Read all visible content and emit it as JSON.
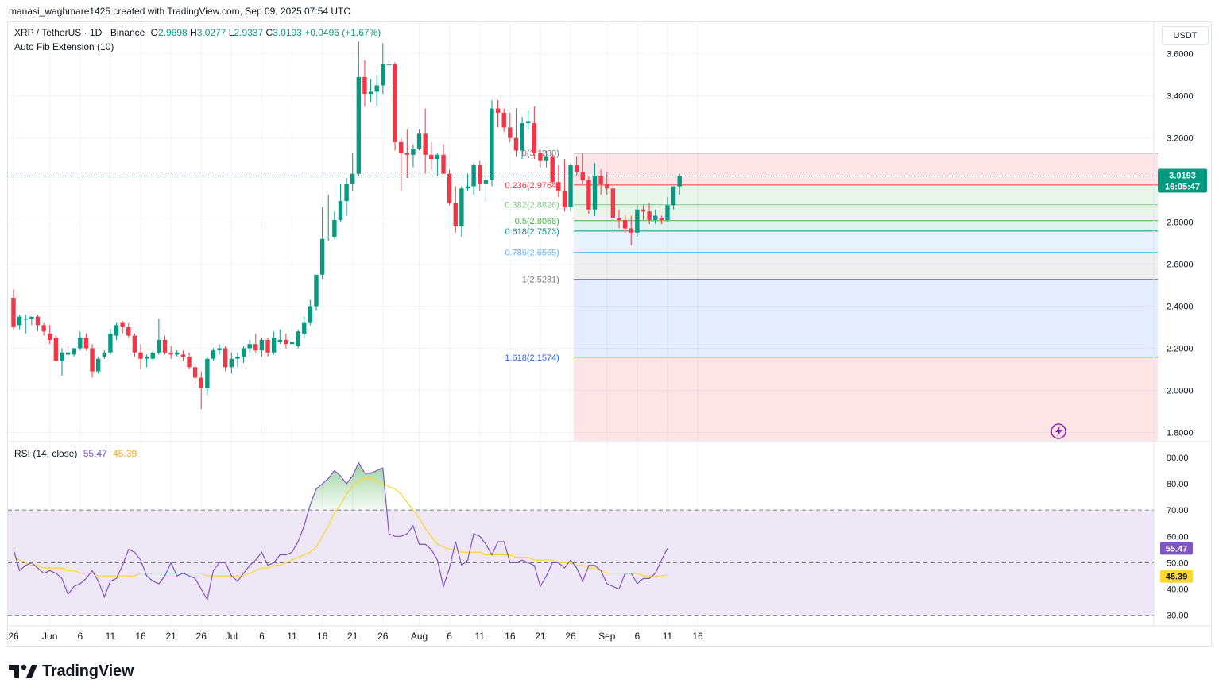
{
  "header": {
    "attribution": "manasi_waghmare1425 created with TradingView.com, Sep 09, 2025 07:54 UTC"
  },
  "legend": {
    "symbol": "XRP / TetherUS · 1D · Binance",
    "o_label": "O",
    "o_value": "2.9698",
    "h_label": "H",
    "h_value": "3.0277",
    "l_label": "L",
    "l_value": "2.9337",
    "c_label": "C",
    "c_value": "3.0193",
    "change": "+0.0496 (+1.67%)",
    "indicator": "Auto Fib Extension (10)"
  },
  "currency_button": "USDT",
  "rsi_legend": {
    "label": "RSI (14, close)",
    "rsi_value": "55.47",
    "ma_value": "45.39"
  },
  "price_badge": {
    "price": "3.0193",
    "countdown": "16:05:47"
  },
  "logo": {
    "text": "TradingView"
  },
  "colors": {
    "up": "#089981",
    "down": "#f23645",
    "rsi": "#7e57c2",
    "rsi_ma": "#fdd835",
    "rsi_band": "#ede7f6",
    "fib_line": "#787b86",
    "grid": "#f0f3fa"
  },
  "chart_data": [
    {
      "type": "candlestick",
      "title": "XRP / TetherUS · 1D · Binance",
      "ylim": [
        1.76,
        3.75
      ],
      "yticks": [
        1.8,
        2.0,
        2.2,
        2.4,
        2.6,
        2.8,
        3.0,
        3.2,
        3.4,
        3.6
      ],
      "ytick_labels": [
        "1.8000",
        "2.0000",
        "2.2000",
        "2.4000",
        "2.6000",
        "2.8000",
        "3.0000",
        "3.2000",
        "3.4000",
        "3.6000"
      ],
      "x_tick_labels": [
        {
          "day": 0,
          "label": "26"
        },
        {
          "day": 6,
          "label": "Jun"
        },
        {
          "day": 11,
          "label": "6"
        },
        {
          "day": 16,
          "label": "11"
        },
        {
          "day": 21,
          "label": "16"
        },
        {
          "day": 26,
          "label": "21"
        },
        {
          "day": 31,
          "label": "26"
        },
        {
          "day": 36,
          "label": "Jul"
        },
        {
          "day": 41,
          "label": "6"
        },
        {
          "day": 46,
          "label": "11"
        },
        {
          "day": 51,
          "label": "16"
        },
        {
          "day": 56,
          "label": "21"
        },
        {
          "day": 61,
          "label": "26"
        },
        {
          "day": 67,
          "label": "Aug"
        },
        {
          "day": 72,
          "label": "6"
        },
        {
          "day": 77,
          "label": "11"
        },
        {
          "day": 82,
          "label": "16"
        },
        {
          "day": 87,
          "label": "21"
        },
        {
          "day": 92,
          "label": "26"
        },
        {
          "day": 98,
          "label": "Sep"
        },
        {
          "day": 103,
          "label": "6"
        },
        {
          "day": 108,
          "label": "11"
        },
        {
          "day": 113,
          "label": "16"
        }
      ],
      "candles": [
        [
          2.44,
          2.48,
          2.29,
          2.3
        ],
        [
          2.31,
          2.36,
          2.29,
          2.35
        ],
        [
          2.34,
          2.36,
          2.27,
          2.34
        ],
        [
          2.34,
          2.35,
          2.31,
          2.35
        ],
        [
          2.35,
          2.36,
          2.28,
          2.31
        ],
        [
          2.31,
          2.32,
          2.26,
          2.28
        ],
        [
          2.27,
          2.31,
          2.22,
          2.24
        ],
        [
          2.25,
          2.26,
          2.14,
          2.14
        ],
        [
          2.14,
          2.2,
          2.07,
          2.18
        ],
        [
          2.17,
          2.21,
          2.15,
          2.18
        ],
        [
          2.17,
          2.2,
          2.16,
          2.2
        ],
        [
          2.2,
          2.28,
          2.19,
          2.25
        ],
        [
          2.25,
          2.27,
          2.19,
          2.2
        ],
        [
          2.2,
          2.22,
          2.06,
          2.09
        ],
        [
          2.09,
          2.16,
          2.08,
          2.15
        ],
        [
          2.16,
          2.19,
          2.15,
          2.18
        ],
        [
          2.18,
          2.29,
          2.17,
          2.27
        ],
        [
          2.26,
          2.32,
          2.24,
          2.31
        ],
        [
          2.32,
          2.33,
          2.27,
          2.3
        ],
        [
          2.3,
          2.32,
          2.25,
          2.26
        ],
        [
          2.26,
          2.27,
          2.16,
          2.18
        ],
        [
          2.18,
          2.22,
          2.1,
          2.15
        ],
        [
          2.15,
          2.17,
          2.11,
          2.16
        ],
        [
          2.15,
          2.19,
          2.14,
          2.18
        ],
        [
          2.18,
          2.34,
          2.17,
          2.24
        ],
        [
          2.24,
          2.26,
          2.17,
          2.18
        ],
        [
          2.18,
          2.21,
          2.15,
          2.17
        ],
        [
          2.17,
          2.19,
          2.16,
          2.18
        ],
        [
          2.17,
          2.19,
          2.14,
          2.16
        ],
        [
          2.16,
          2.18,
          2.1,
          2.11
        ],
        [
          2.11,
          2.13,
          2.03,
          2.06
        ],
        [
          2.06,
          2.09,
          1.91,
          2.01
        ],
        [
          2.01,
          2.16,
          1.98,
          2.15
        ],
        [
          2.15,
          2.2,
          2.14,
          2.19
        ],
        [
          2.19,
          2.22,
          2.17,
          2.2
        ],
        [
          2.2,
          2.21,
          2.09,
          2.11
        ],
        [
          2.11,
          2.18,
          2.08,
          2.15
        ],
        [
          2.15,
          2.18,
          2.11,
          2.16
        ],
        [
          2.16,
          2.21,
          2.13,
          2.2
        ],
        [
          2.2,
          2.24,
          2.18,
          2.22
        ],
        [
          2.22,
          2.27,
          2.18,
          2.19
        ],
        [
          2.19,
          2.25,
          2.16,
          2.24
        ],
        [
          2.24,
          2.25,
          2.16,
          2.18
        ],
        [
          2.18,
          2.28,
          2.17,
          2.25
        ],
        [
          2.23,
          2.29,
          2.22,
          2.24
        ],
        [
          2.24,
          2.27,
          2.2,
          2.22
        ],
        [
          2.22,
          2.27,
          2.21,
          2.23
        ],
        [
          2.21,
          2.29,
          2.2,
          2.28
        ],
        [
          2.27,
          2.35,
          2.25,
          2.32
        ],
        [
          2.32,
          2.43,
          2.31,
          2.4
        ],
        [
          2.4,
          2.54,
          2.38,
          2.55
        ],
        [
          2.55,
          2.87,
          2.53,
          2.72
        ],
        [
          2.73,
          2.93,
          2.71,
          2.73
        ],
        [
          2.73,
          2.85,
          2.72,
          2.81
        ],
        [
          2.81,
          2.98,
          2.8,
          2.9
        ],
        [
          2.9,
          3.01,
          2.83,
          2.98
        ],
        [
          2.98,
          3.13,
          2.95,
          3.03
        ],
        [
          3.03,
          3.66,
          3.02,
          3.49
        ],
        [
          3.49,
          3.57,
          3.35,
          3.41
        ],
        [
          3.41,
          3.48,
          3.37,
          3.42
        ],
        [
          3.42,
          3.5,
          3.35,
          3.45
        ],
        [
          3.45,
          3.65,
          3.41,
          3.55
        ],
        [
          3.55,
          3.57,
          3.44,
          3.55
        ],
        [
          3.55,
          3.56,
          3.14,
          3.18
        ],
        [
          3.18,
          3.2,
          2.95,
          3.13
        ],
        [
          3.13,
          3.24,
          3.01,
          3.12
        ],
        [
          3.12,
          3.17,
          3.06,
          3.15
        ],
        [
          3.15,
          3.24,
          3.14,
          3.22
        ],
        [
          3.22,
          3.34,
          3.03,
          3.12
        ],
        [
          3.12,
          3.18,
          3.05,
          3.1
        ],
        [
          3.1,
          3.13,
          3.02,
          3.12
        ],
        [
          3.12,
          3.17,
          3.04,
          3.03
        ],
        [
          3.03,
          3.05,
          2.88,
          2.89
        ],
        [
          2.89,
          2.97,
          2.75,
          2.78
        ],
        [
          2.78,
          2.97,
          2.73,
          2.96
        ],
        [
          2.96,
          3.03,
          2.95,
          2.97
        ],
        [
          2.97,
          3.08,
          2.93,
          3.07
        ],
        [
          3.07,
          3.09,
          2.95,
          2.98
        ],
        [
          2.98,
          3.08,
          2.9,
          3.0
        ],
        [
          3.0,
          3.38,
          2.97,
          3.34
        ],
        [
          3.34,
          3.38,
          3.25,
          3.32
        ],
        [
          3.32,
          3.34,
          3.23,
          3.25
        ],
        [
          3.25,
          3.32,
          3.18,
          3.2
        ],
        [
          3.2,
          3.34,
          3.11,
          3.14
        ],
        [
          3.14,
          3.3,
          3.1,
          3.27
        ],
        [
          3.27,
          3.33,
          3.24,
          3.28
        ],
        [
          3.27,
          3.35,
          3.1,
          3.13
        ],
        [
          3.13,
          3.15,
          3.06,
          3.09
        ],
        [
          3.09,
          3.14,
          3.06,
          3.11
        ],
        [
          3.11,
          3.13,
          2.98,
          2.99
        ],
        [
          2.99,
          3.07,
          2.92,
          2.95
        ],
        [
          2.95,
          3.1,
          2.85,
          2.87
        ],
        [
          2.87,
          3.08,
          2.85,
          3.07
        ],
        [
          3.07,
          3.11,
          3.02,
          3.04
        ],
        [
          3.04,
          3.13,
          2.98,
          3.0
        ],
        [
          3.0,
          3.02,
          2.84,
          2.86
        ],
        [
          2.86,
          3.08,
          2.83,
          3.02
        ],
        [
          3.02,
          3.05,
          2.93,
          2.98
        ],
        [
          2.98,
          3.04,
          2.93,
          2.96
        ],
        [
          2.96,
          2.98,
          2.76,
          2.82
        ],
        [
          2.82,
          2.86,
          2.77,
          2.81
        ],
        [
          2.81,
          2.83,
          2.75,
          2.77
        ],
        [
          2.77,
          2.83,
          2.69,
          2.75
        ],
        [
          2.75,
          2.88,
          2.73,
          2.86
        ],
        [
          2.86,
          2.88,
          2.81,
          2.85
        ],
        [
          2.85,
          2.89,
          2.79,
          2.81
        ],
        [
          2.81,
          2.86,
          2.79,
          2.83
        ],
        [
          2.82,
          2.83,
          2.79,
          2.81
        ],
        [
          2.81,
          2.92,
          2.8,
          2.88
        ],
        [
          2.88,
          2.97,
          2.86,
          2.97
        ],
        [
          2.97,
          3.03,
          2.93,
          3.02
        ]
      ],
      "last_price": 3.0193
    },
    {
      "type": "fib_extension",
      "title": "Auto Fib Extension (10)",
      "levels": [
        {
          "ratio": "0",
          "price": 3.128,
          "label": "0(3.1280)",
          "color": "#787b86"
        },
        {
          "ratio": "0.236",
          "price": 2.9764,
          "label": "0.236(2.9764)",
          "color": "#f23645"
        },
        {
          "ratio": "0.382",
          "price": 2.8826,
          "label": "0.382(2.8826)",
          "color": "#81c784"
        },
        {
          "ratio": "0.5",
          "price": 2.8068,
          "label": "0.5(2.8068)",
          "color": "#4caf50"
        },
        {
          "ratio": "0.618",
          "price": 2.7573,
          "label": "0.618(2.7573)",
          "color": "#089981"
        },
        {
          "ratio": "0.786",
          "price": 2.6565,
          "label": "0.786(2.6565)",
          "color": "#64b5f6"
        },
        {
          "ratio": "1",
          "price": 2.5281,
          "label": "1(2.5281)",
          "color": "#787b86"
        },
        {
          "ratio": "1.618",
          "price": 2.1574,
          "label": "1.618(2.1574)",
          "color": "#2962ff"
        }
      ],
      "start_day": 92.5
    },
    {
      "type": "line",
      "title": "RSI (14, close)",
      "ylim": [
        26,
        96
      ],
      "yticks": [
        30,
        40,
        50,
        60,
        70,
        80,
        90
      ],
      "ytick_labels": [
        "30.00",
        "40.00",
        "50.00",
        "60.00",
        "70.00",
        "80.00",
        "90.00"
      ],
      "band": [
        30,
        70
      ],
      "series": [
        {
          "name": "RSI",
          "values": [
            55,
            47,
            49,
            50,
            48,
            46,
            47,
            46,
            44,
            38,
            41,
            42,
            44,
            47,
            43,
            37,
            43,
            44,
            49,
            55,
            54,
            51,
            45,
            43,
            42,
            45,
            50,
            45,
            46,
            45,
            44,
            40,
            36,
            47,
            50,
            50,
            45,
            43,
            46,
            49,
            51,
            54,
            49,
            50,
            53,
            53,
            54,
            58,
            64,
            72,
            78,
            80,
            82,
            85,
            83,
            80,
            83,
            88,
            84,
            84,
            85,
            86,
            61,
            60,
            60,
            61,
            64,
            57,
            57,
            55,
            51,
            41,
            48,
            58,
            49,
            51,
            61,
            60,
            57,
            53,
            58,
            58,
            50,
            50,
            51,
            50,
            49,
            41,
            45,
            50,
            50,
            48,
            51,
            48,
            43,
            49,
            49,
            47,
            42,
            41,
            40,
            46,
            46,
            42,
            44,
            44,
            46,
            51,
            55.47
          ]
        },
        {
          "name": "MA",
          "values": [
            52,
            51,
            50,
            49,
            49,
            48,
            48,
            48,
            48,
            47,
            47,
            46,
            46,
            46,
            45,
            45,
            45,
            45,
            45,
            45,
            45,
            46,
            46,
            46,
            46,
            46,
            46,
            46,
            46,
            46,
            46,
            46,
            45,
            45,
            45,
            45,
            45,
            45,
            45,
            46,
            47,
            48,
            48,
            49,
            49,
            50,
            51,
            52,
            53,
            54,
            56,
            60,
            64,
            69,
            72,
            76,
            79,
            81,
            82,
            82,
            81,
            80,
            79,
            78,
            76,
            73,
            70,
            67,
            63,
            60,
            57,
            56,
            55,
            55,
            54,
            54,
            54,
            54,
            53,
            53,
            53,
            53,
            53,
            52,
            52,
            52,
            51,
            51,
            51,
            51,
            50,
            50,
            50,
            49,
            49,
            48,
            48,
            47,
            46,
            46,
            46,
            46,
            46,
            46,
            45,
            45,
            45,
            45,
            45.39
          ]
        }
      ]
    }
  ]
}
